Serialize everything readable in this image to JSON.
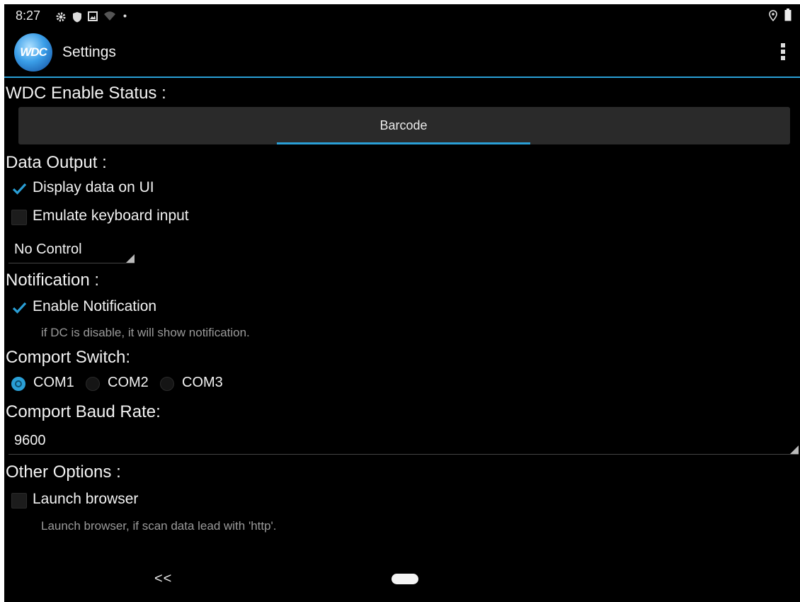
{
  "status_bar": {
    "time": "8:27",
    "left_icons": [
      "gear-icon",
      "shield-icon",
      "image-icon",
      "wifi-off-icon",
      "dot-icon"
    ],
    "right_icons": [
      "location-icon",
      "battery-icon"
    ]
  },
  "action_bar": {
    "logo_text": "WDC",
    "title": "Settings",
    "overflow_icon": "more-vertical-icon"
  },
  "wdc_enable": {
    "heading": "WDC Enable Status :",
    "tabs": [
      {
        "label": "Barcode",
        "selected": true
      }
    ]
  },
  "data_output": {
    "heading": "Data Output :",
    "display_on_ui": {
      "label": "Display data on UI",
      "checked": true
    },
    "emulate_keyboard": {
      "label": "Emulate keyboard input",
      "checked": false
    },
    "control_spinner": {
      "value": "No Control"
    }
  },
  "notification": {
    "heading": "Notification :",
    "enable": {
      "label": "Enable Notification",
      "checked": true
    },
    "hint": "if DC is disable, it will show notification."
  },
  "comport": {
    "heading": "Comport Switch:",
    "options": [
      {
        "label": "COM1",
        "selected": true
      },
      {
        "label": "COM2",
        "selected": false
      },
      {
        "label": "COM3",
        "selected": false
      }
    ]
  },
  "baud": {
    "heading": "Comport Baud Rate:",
    "value": "9600"
  },
  "other": {
    "heading": "Other Options :",
    "launch_browser": {
      "label": "Launch browser",
      "checked": false
    },
    "hint": "Launch browser, if scan data lead with 'http'."
  },
  "nav_bar": {
    "back": "<<"
  },
  "colors": {
    "accent": "#2a9fd6",
    "background": "#000000",
    "tab_bg": "#2a2a2a"
  }
}
